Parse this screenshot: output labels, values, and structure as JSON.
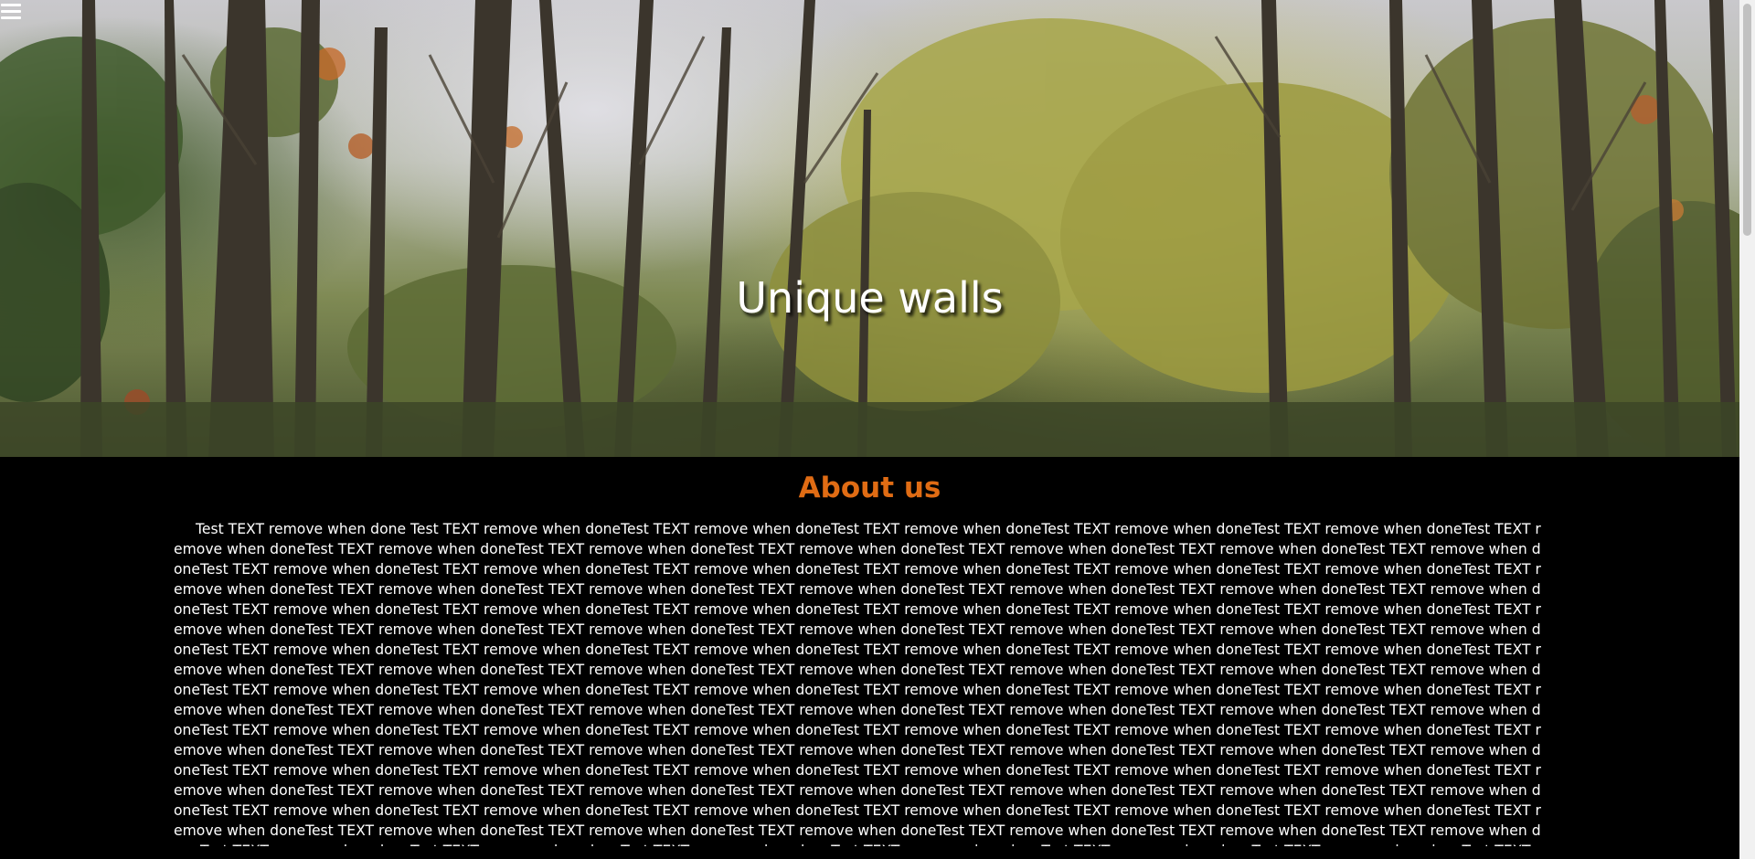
{
  "hero": {
    "title": "Unique walls"
  },
  "menu": {
    "icon": "hamburger-menu-icon"
  },
  "about": {
    "title": "About us",
    "body": "Test TEXT remove when done Test TEXT remove when doneTest TEXT remove when doneTest TEXT remove when doneTest TEXT remove when doneTest TEXT remove when doneTest TEXT remove when doneTest TEXT remove when doneTest TEXT remove when doneTest TEXT remove when doneTest TEXT remove when doneTest TEXT remove when doneTest TEXT remove when doneTest TEXT remove when doneTest TEXT remove when doneTest TEXT remove when doneTest TEXT remove when doneTest TEXT remove when doneTest TEXT remove when doneTest TEXT remove when doneTest TEXT remove when doneTest TEXT remove when doneTest TEXT remove when doneTest TEXT remove when doneTest TEXT remove when doneTest TEXT remove when doneTest TEXT remove when doneTest TEXT remove when doneTest TEXT remove when doneTest TEXT remove when doneTest TEXT remove when doneTest TEXT remove when doneTest TEXT remove when doneTest TEXT remove when doneTest TEXT remove when doneTest TEXT remove when doneTest TEXT remove when doneTest TEXT remove when doneTest TEXT remove when doneTest TEXT remove when doneTest TEXT remove when doneTest TEXT remove when doneTest TEXT remove when doneTest TEXT remove when doneTest TEXT remove when doneTest TEXT remove when doneTest TEXT remove when doneTest TEXT remove when doneTest TEXT remove when doneTest TEXT remove when doneTest TEXT remove when doneTest TEXT remove when doneTest TEXT remove when doneTest TEXT remove when doneTest TEXT remove when doneTest TEXT remove when doneTest TEXT remove when doneTest TEXT remove when doneTest TEXT remove when doneTest TEXT remove when doneTest TEXT remove when doneTest TEXT remove when doneTest TEXT remove when doneTest TEXT remove when doneTest TEXT remove when doneTest TEXT remove when doneTest TEXT remove when doneTest TEXT remove when doneTest TEXT remove when doneTest TEXT remove when doneTest TEXT remove when doneTest TEXT remove when doneTest TEXT remove when doneTest TEXT remove when doneTest TEXT remove when doneTest TEXT remove when doneTest TEXT remove when doneTest TEXT remove when doneTest TEXT remove when doneTest TEXT remove when doneTest TEXT remove when doneTest TEXT remove when doneTest TEXT remove when doneTest TEXT remove when doneTest TEXT remove when doneTest TEXT remove when doneTest TEXT remove when doneTest TEXT remove when doneTest TEXT remove when doneTest TEXT remove when doneTest TEXT remove when doneTest TEXT remove when doneTest TEXT remove when doneTest TEXT remove when doneTest TEXT remove when doneTest TEXT remove when doneTest TEXT remove when doneTest TEXT remove when doneTest TEXT remove when doneTest TEXT remove when doneTest TEXT remove when doneTest TEXT remove when doneTest TEXT remove when doneTest TEXT remove when doneTest TEXT remove when doneTest TEXT remove when doneTest TEXT remove when doneTest TEXT remove when doneTest TEXT remove when doneTest TEXT remove when doneTest TEXT remove when doneTest TEXT remove when doneTest TEXT remove when doneTest TEXT remove when doneTest TEXT remove when doneTest TEXT remove when doneTest TEXT remove when doneTest TEXT remove when doneTest TEXT remove when doneTest TEXT remove when doneTest TEXT remove when doneTest TEXT remove when doneTest TEXT remove when doneTest TEXT remove when doneTest TEXT remove when doneTest TEXT remove when doneTest TEXT remove when doneTest TEXT remove when doneTest TEXT remove when doneTest TEXT remove when doneTest TEXT remove when doneTest TEXT remove when doneTest TEXT remove when doneTest TEXT remove when doneTest TEXT remove when doneTest TEXT remove when doneTest TEXT remove when doneTest TEXT remove when doneTest TEXT remove when doneTest TEXT remove when doneTest TEXT remove when doneTest TEXT remove when doneTest TEXT remove when don"
  },
  "colors": {
    "accent": "#e06c14",
    "background": "#000000",
    "text": "#ffffff"
  },
  "scrollbar": {
    "position": 0.0
  }
}
